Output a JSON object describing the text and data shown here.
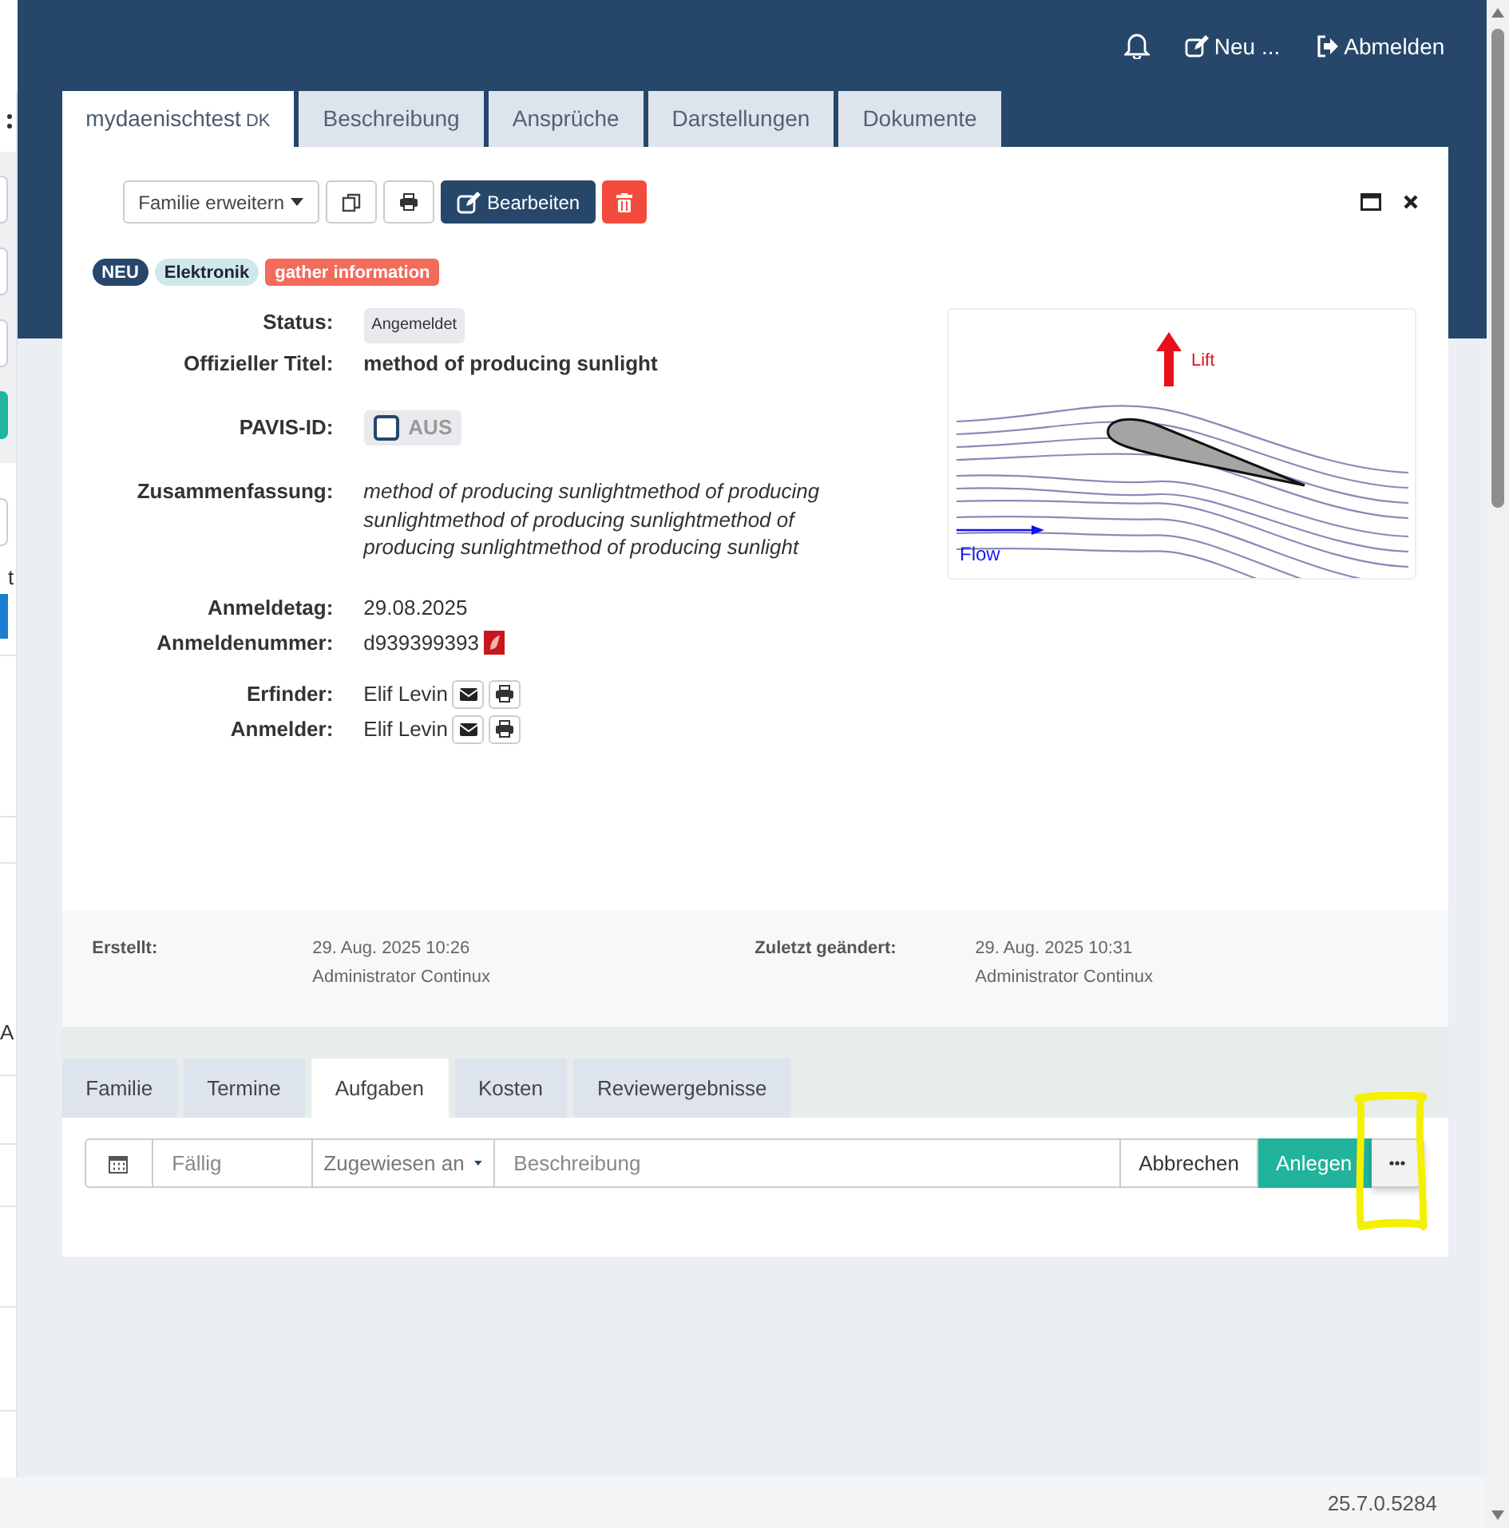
{
  "topbar": {
    "actions": [
      {
        "kind": "new",
        "label": "Neu ..."
      },
      {
        "kind": "logout",
        "label": "Abmelden"
      }
    ]
  },
  "sidebar": {
    "fragments": [
      "t",
      "A"
    ]
  },
  "tabs": [
    {
      "label": "mydaenischtest",
      "suffix": "DK",
      "selected": true
    },
    {
      "label": "Beschreibung",
      "selected": false
    },
    {
      "label": "Ansprüche",
      "selected": false
    },
    {
      "label": "Darstellungen",
      "selected": false
    },
    {
      "label": "Dokumente",
      "selected": false
    }
  ],
  "toolbar": {
    "dropdown": "Familie erweitern",
    "edit_button": "Bearbeiten"
  },
  "badges": [
    {
      "label": "NEU",
      "color": "#26476a"
    },
    {
      "label": "Elektronik",
      "color": "#cfe8ea"
    },
    {
      "label": "gather information",
      "color": "#f26b5b"
    }
  ],
  "fields": [
    {
      "kind": "status",
      "label": "Status:",
      "value": "Angemeldet"
    },
    {
      "kind": "title",
      "label": "Offizieller Titel:",
      "value": "method of producing sunlight"
    },
    {
      "kind": "toggle",
      "label": "PAVIS-ID:",
      "value": "AUS",
      "on": false
    },
    {
      "kind": "summary",
      "label": "Zusammenfassung:",
      "value": "method of producing sunlightmethod of producing sunlightmethod of producing sunlightmethod of producing sunlightmethod of producing sunlight"
    },
    {
      "kind": "date",
      "label": "Anmeldetag:",
      "value": "29.08.2025"
    },
    {
      "kind": "number",
      "label": "Anmeldenummer:",
      "value": "d939399393"
    },
    {
      "kind": "person",
      "label": "Erfinder:",
      "value": "Elif Levin"
    },
    {
      "kind": "person",
      "label": "Anmelder:",
      "value": "Elif Levin"
    }
  ],
  "figure": {
    "lift": "Lift",
    "flow": "Flow"
  },
  "meta": [
    {
      "label": "Erstellt:",
      "date": "29. Aug. 2025 10:26",
      "user": "Administrator Continux"
    },
    {
      "label": "Zuletzt geändert:",
      "date": "29. Aug. 2025 10:31",
      "user": "Administrator Continux"
    }
  ],
  "lower_tabs": [
    {
      "label": "Familie",
      "selected": false
    },
    {
      "label": "Termine",
      "selected": false
    },
    {
      "label": "Aufgaben",
      "selected": true
    },
    {
      "label": "Kosten",
      "selected": false
    },
    {
      "label": "Reviewergebnisse",
      "selected": false
    }
  ],
  "task_form": {
    "due_placeholder": "Fällig",
    "assignee": "Zugewiesen an",
    "description_placeholder": "Beschreibung",
    "cancel": "Abbrechen",
    "create": "Anlegen"
  },
  "version": "25.7.0.5284"
}
